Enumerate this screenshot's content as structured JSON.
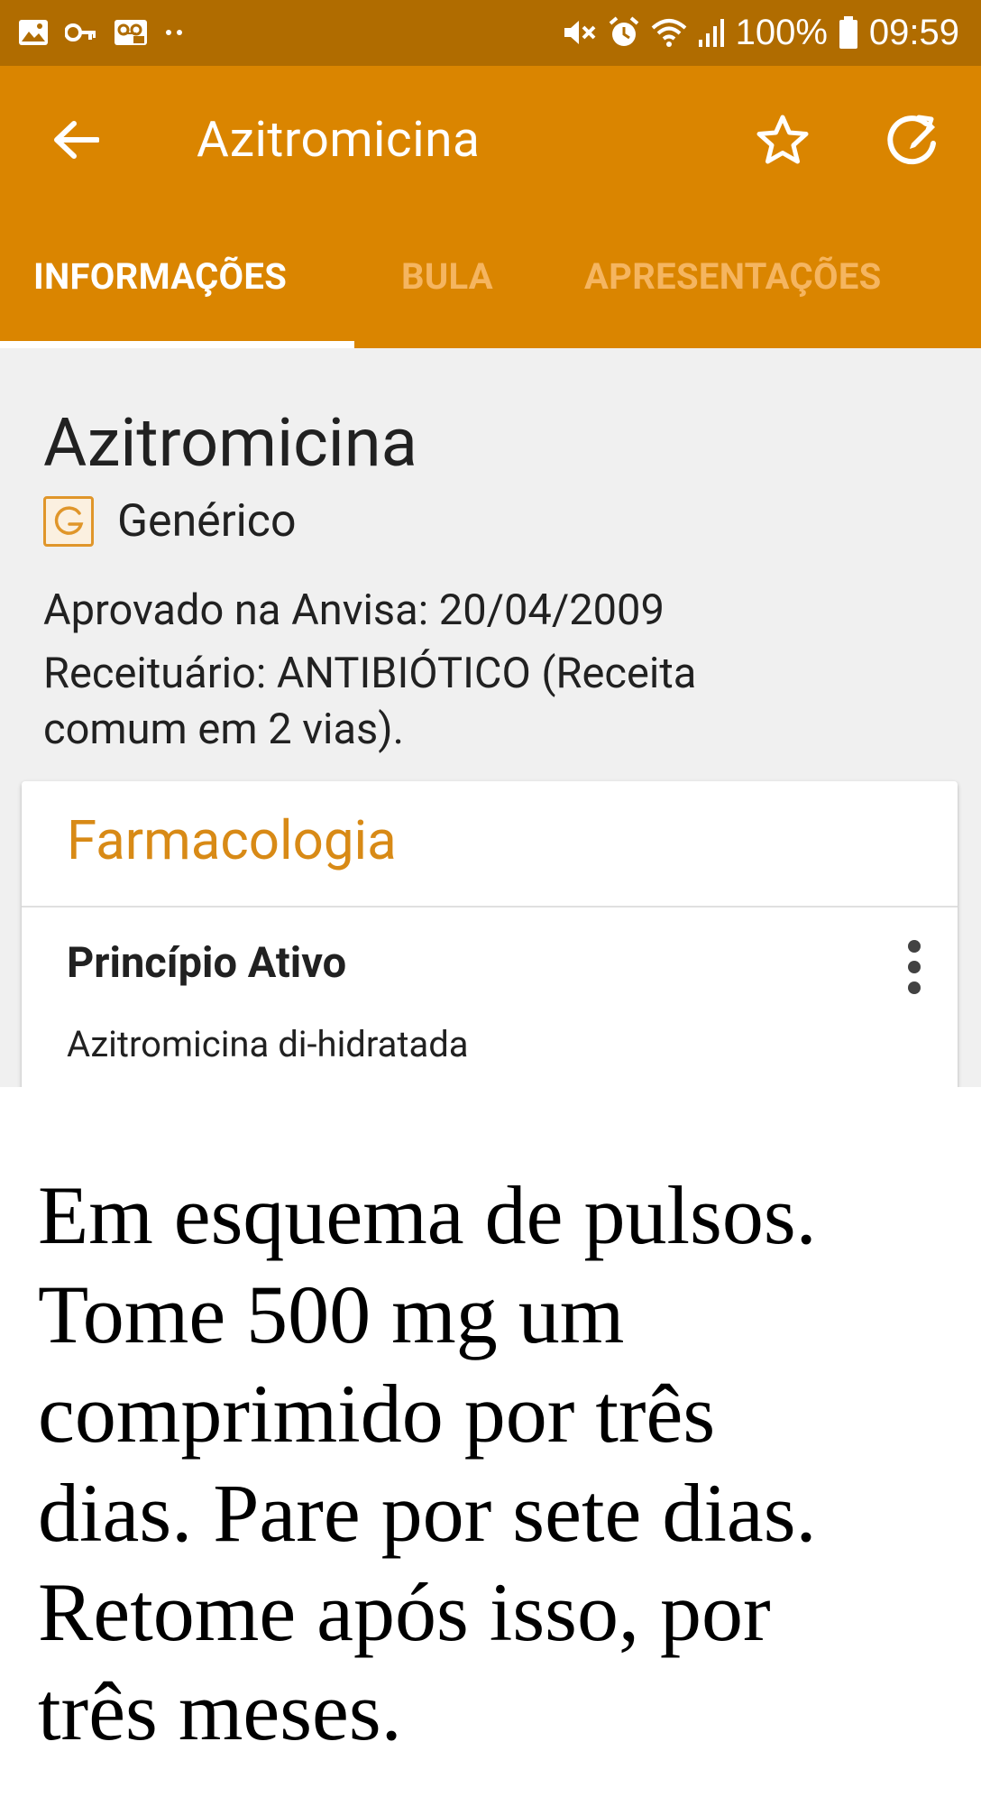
{
  "status_bar": {
    "battery": "100%",
    "time": "09:59"
  },
  "appbar": {
    "title": "Azitromicina",
    "icons": [
      "back-arrow-icon",
      "star-icon",
      "update-icon"
    ]
  },
  "tabs": [
    {
      "label": "INFORMAÇÕES",
      "active": true
    },
    {
      "label": "BULA",
      "active": false
    },
    {
      "label": "APRESENTAÇÕES",
      "active": false
    }
  ],
  "drug": {
    "name": "Azitromicina",
    "badge_letter": "G",
    "type": "Genérico",
    "approval": "Aprovado na Anvisa: 20/04/2009",
    "prescription_line1": "Receituário: ANTIBIÓTICO (Receita",
    "prescription_line2": "comum em 2 vias)."
  },
  "pharmacology": {
    "header": "Farmacologia",
    "field_label": "Princípio Ativo",
    "field_value": "Azitromicina di-hidratada"
  },
  "caption": {
    "lines": [
      "Em esquema de pulsos.",
      "Tome 500 mg um",
      "comprimido por três",
      "dias. Pare por sete dias.",
      "Retome após isso, por",
      "três meses."
    ]
  },
  "colors": {
    "status_bar": "#b06c00",
    "appbar": "#da8500",
    "accent_text": "#d88a16",
    "inactive_tab": "#f5b560"
  }
}
